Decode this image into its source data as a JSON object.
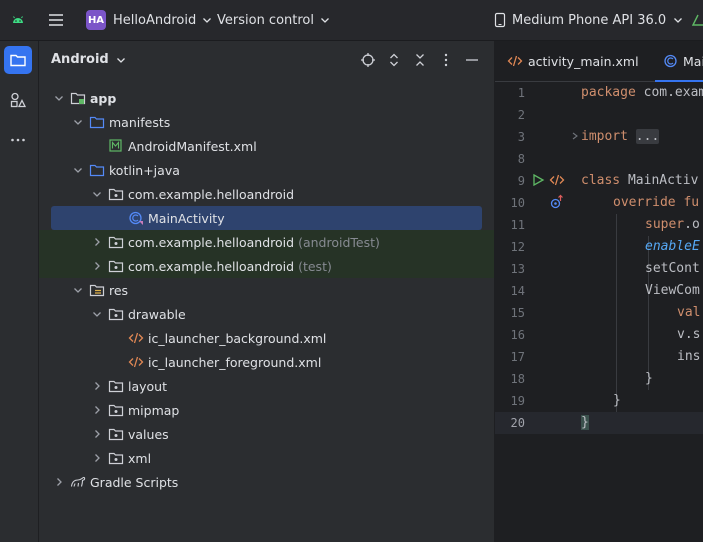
{
  "titlebar": {
    "project_badge": "HA",
    "project_name": "HelloAndroid",
    "vcs_label": "Version control",
    "device": "Medium Phone API 36.0"
  },
  "panel": {
    "title": "Android"
  },
  "tree": [
    {
      "label": "app",
      "bold": true,
      "suffix": ""
    },
    {
      "label": "manifests",
      "suffix": ""
    },
    {
      "label": "AndroidManifest.xml",
      "suffix": ""
    },
    {
      "label": "kotlin+java",
      "suffix": ""
    },
    {
      "label": "com.example.helloandroid",
      "suffix": ""
    },
    {
      "label": "MainActivity",
      "suffix": ""
    },
    {
      "label": "com.example.helloandroid",
      "suffix": "(androidTest)"
    },
    {
      "label": "com.example.helloandroid",
      "suffix": "(test)"
    },
    {
      "label": "res",
      "suffix": ""
    },
    {
      "label": "drawable",
      "suffix": ""
    },
    {
      "label": "ic_launcher_background.xml",
      "suffix": ""
    },
    {
      "label": "ic_launcher_foreground.xml",
      "suffix": ""
    },
    {
      "label": "layout",
      "suffix": ""
    },
    {
      "label": "mipmap",
      "suffix": ""
    },
    {
      "label": "values",
      "suffix": ""
    },
    {
      "label": "xml",
      "suffix": ""
    },
    {
      "label": "Gradle Scripts",
      "suffix": ""
    }
  ],
  "editor": {
    "tabs": [
      {
        "label": "activity_main.xml"
      },
      {
        "label": "Mai"
      }
    ],
    "line_numbers": [
      "1",
      "2",
      "3",
      "8",
      "9",
      "10",
      "11",
      "12",
      "13",
      "14",
      "15",
      "16",
      "17",
      "18",
      "19",
      "20"
    ],
    "code": {
      "l1_kw": "package",
      "l1_txt": " com.exam",
      "l3_kw": "import",
      "l3_fold": "...",
      "l9_kw": "class",
      "l9_txt": " MainActiv",
      "l10_kw": "override",
      "l10_kw2": " fu",
      "l11_pur": "super",
      "l11_txt": ".o",
      "l12_it": "enableE",
      "l13_txt": "setCont",
      "l14_txt": "ViewCom",
      "l15_kw": "val",
      "l16_txt": "v.s",
      "l17_txt": "ins",
      "l18_txt": "}",
      "l19_txt": "}",
      "l20_txt": "}"
    }
  },
  "colors": {
    "accent": "#3574f0",
    "selection": "#2e436e",
    "test_bg": "#263326",
    "keyword": "#cf8e6d",
    "function": "#56a8f5",
    "badge": "#7b55c8"
  }
}
